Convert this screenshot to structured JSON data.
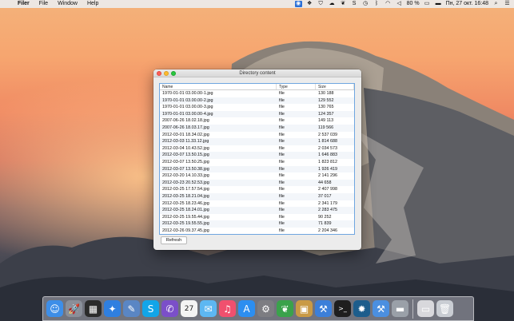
{
  "menubar": {
    "app_name": "Filer",
    "menus": [
      "File",
      "Window",
      "Help"
    ],
    "status": {
      "battery": "80 %",
      "clock": "Пн, 27 окт.  16:48"
    }
  },
  "window": {
    "title": "Directory content",
    "columns": [
      "Name",
      "Type",
      "Size"
    ],
    "rows": [
      [
        "1970-01-01 03.00.00-1.jpg",
        "file",
        "130 188"
      ],
      [
        "1970-01-01 03.00.00-2.jpg",
        "file",
        "129 552"
      ],
      [
        "1970-01-01 03.00.00-3.jpg",
        "file",
        "130 765"
      ],
      [
        "1970-01-01 03.00.00-4.jpg",
        "file",
        "124 357"
      ],
      [
        "2007-06-26 18.02.18.jpg",
        "file",
        "149 113"
      ],
      [
        "2007-06-26 18.03.17.jpg",
        "file",
        "119 566"
      ],
      [
        "2012-03-01 18.34.02.jpg",
        "file",
        "2 537 039"
      ],
      [
        "2012-03-03 11.33.12.jpg",
        "file",
        "1 814 688"
      ],
      [
        "2012-03-04 10.43.52.jpg",
        "file",
        "2 034 573"
      ],
      [
        "2012-03-07 13.50.15.jpg",
        "file",
        "1 646 883"
      ],
      [
        "2012-03-07 13.50.25.jpg",
        "file",
        "1 823 812"
      ],
      [
        "2012-03-07 13.50.38.jpg",
        "file",
        "1 926 419"
      ],
      [
        "2012-03-20 14.10.33.jpg",
        "file",
        "2 141 296"
      ],
      [
        "2012-03-23 20.52.53.jpg",
        "file",
        "44 658"
      ],
      [
        "2012-03-25 17.57.54.jpg",
        "file",
        "2 407 998"
      ],
      [
        "2012-03-25 18.21.04.jpg",
        "file",
        "37 017"
      ],
      [
        "2012-03-25 18.23.46.jpg",
        "file",
        "2 341 179"
      ],
      [
        "2012-03-25 18.24.01.jpg",
        "file",
        "2 283 475"
      ],
      [
        "2012-03-25 19.55.44.jpg",
        "file",
        "90 252"
      ],
      [
        "2012-03-25 19.55.55.jpg",
        "file",
        "71 839"
      ],
      [
        "2012-03-26 09.37.45.jpg",
        "file",
        "2 204 346"
      ]
    ],
    "refresh_label": "Refresh"
  },
  "dock": {
    "apps": [
      {
        "name": "finder-icon",
        "color": "#3d8ee8",
        "glyph": "☺"
      },
      {
        "name": "launchpad-icon",
        "color": "#8a8f99",
        "glyph": "🚀"
      },
      {
        "name": "mission-control-icon",
        "color": "#2b2b2b",
        "glyph": "▦"
      },
      {
        "name": "safari-icon",
        "color": "#2f7fe0",
        "glyph": "✦"
      },
      {
        "name": "preview-icon",
        "color": "#5a86c4",
        "glyph": "✎"
      },
      {
        "name": "skype-icon",
        "color": "#12a5e8",
        "glyph": "S"
      },
      {
        "name": "viber-icon",
        "color": "#7b4fc9",
        "glyph": "✆"
      },
      {
        "name": "calendar-icon",
        "color": "#f4f4f4",
        "glyph": "27"
      },
      {
        "name": "messages-icon",
        "color": "#5db7f2",
        "glyph": "✉"
      },
      {
        "name": "music-icon",
        "color": "#f0506e",
        "glyph": "♫"
      },
      {
        "name": "app-store-icon",
        "color": "#2c8ef0",
        "glyph": "A"
      },
      {
        "name": "system-preferences-icon",
        "color": "#7d7d82",
        "glyph": "⚙"
      },
      {
        "name": "leaf-app-icon",
        "color": "#3aa24b",
        "glyph": "❦"
      },
      {
        "name": "package-icon",
        "color": "#c99a45",
        "glyph": "▣"
      },
      {
        "name": "xcode-icon",
        "color": "#3c7fd9",
        "glyph": "⚒"
      },
      {
        "name": "terminal-icon",
        "color": "#1e1e1e",
        "glyph": ">_"
      },
      {
        "name": "sourcetree-icon",
        "color": "#1d5d8c",
        "glyph": "✹"
      },
      {
        "name": "xcode-tool-icon",
        "color": "#4b8fe0",
        "glyph": "⚒"
      },
      {
        "name": "disk-utility-icon",
        "color": "#9aa0a8",
        "glyph": "▬"
      },
      {
        "name": "image-capture-icon",
        "color": "#d8d8dc",
        "glyph": "▭"
      },
      {
        "name": "trash-icon",
        "color": "#c9cdd3",
        "glyph": "🗑"
      }
    ]
  }
}
